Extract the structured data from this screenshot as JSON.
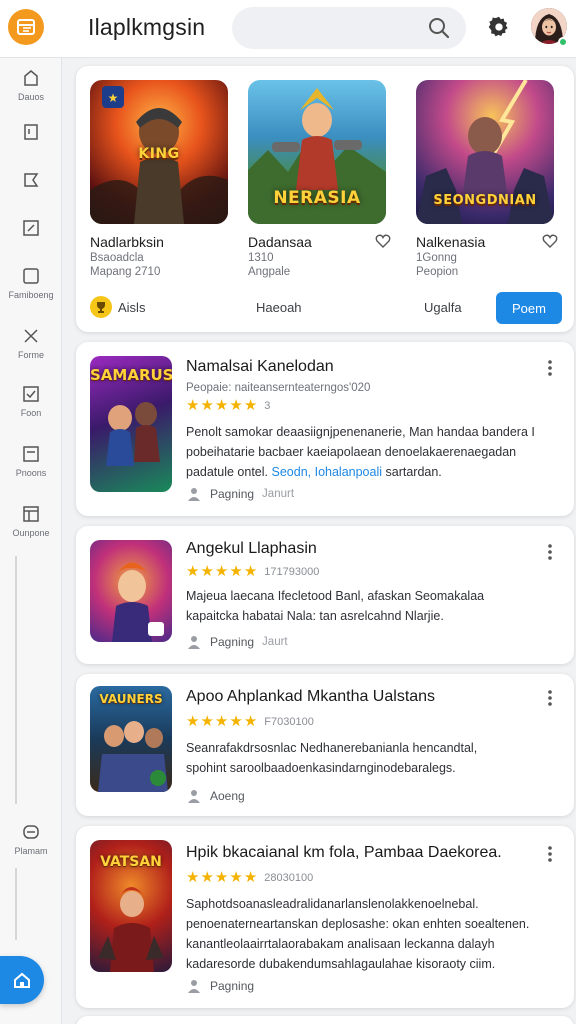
{
  "header": {
    "title": "Ilaplkmgsin",
    "search_placeholder": "",
    "icons": {
      "logo": "app-grid-logo-icon",
      "search": "search-icon",
      "settings": "gear-icon",
      "avatar": "user-avatar"
    }
  },
  "sidebar": {
    "items": [
      {
        "label": "Dauos",
        "icon": "home-icon"
      },
      {
        "label": "",
        "icon": "document-icon"
      },
      {
        "label": "",
        "icon": "tag-icon"
      },
      {
        "label": "",
        "icon": "edit-icon"
      },
      {
        "label": "Famiboeng",
        "icon": "square-icon"
      },
      {
        "label": "Forme",
        "icon": "close-icon"
      },
      {
        "label": "Foon",
        "icon": "checkbox-icon"
      },
      {
        "label": "Pnoons",
        "icon": "list-icon"
      },
      {
        "label": "Ounpone",
        "icon": "layout-icon"
      },
      {
        "label": "Plamam",
        "icon": "archive-icon"
      }
    ],
    "fab_icon": "home-icon"
  },
  "featured": {
    "items": [
      {
        "name": "Nadlarbksin",
        "line1": "Bsaoadcla",
        "line2": "Mapang 2710",
        "art_title": "KING",
        "like_icon": ""
      },
      {
        "name": "Dadansaa",
        "line1": "1310",
        "line2": "Angpale",
        "art_title": "NERASIA",
        "like_icon": "heart-icon"
      },
      {
        "name": "Nalkenasia",
        "line1": "1Gonng",
        "line2": "Peopion",
        "art_title": "SEONGDNIAN",
        "like_icon": "heart-icon"
      }
    ],
    "footer": {
      "left": "Aisls",
      "middle": "Haeoah",
      "right": "Ugalfa",
      "button": "Poem"
    }
  },
  "list": [
    {
      "title": "Namalsai Kanelodan",
      "meta": "Peopaie: naiteansernteaterngos'020",
      "stars": 5,
      "rating": "3",
      "art_title": "SAMARUS",
      "desc1": "Penolt samokar deaasiignjpenenanerie, Man handaa bandera I",
      "desc2": "pobeihatarie bacbaer kaeiapolaean denoelakaerenaegadan",
      "desc3_pre": "padatule ontel.",
      "desc3_link": "Seodn, Iohalanpoali",
      "desc3_post": "sartardan.",
      "foot_label": "Pagning",
      "foot_extra": "Janurt"
    },
    {
      "title": "Angekul Llaphasin",
      "meta": "",
      "stars": 5,
      "rating": "171793000",
      "art_title": "",
      "desc1": "Majeua laecana Ifecletood Banl, afaskan Seomakalaa",
      "desc2": "kapaitcka habatai Nala: tan asrelcahnd Nlarjie.",
      "desc3_pre": "",
      "desc3_link": "",
      "desc3_post": "",
      "foot_label": "Pagning",
      "foot_extra": "Jaurt"
    },
    {
      "title": "Apoo Ahplankad Mkantha Ualstans",
      "meta": "",
      "stars": 5,
      "rating": "F7030100",
      "art_title": "VAUNERS",
      "desc1": "Seanrafakdrsosnlac Nedhanerebanianla hencandtal,",
      "desc2": "spohint saroolbaadoenkasindarnginodebaralegs.",
      "desc3_pre": "",
      "desc3_link": "",
      "desc3_post": "",
      "foot_label": "Aoeng",
      "foot_extra": ""
    },
    {
      "title": "Hpik bkacaianal km fola, Pambaa Daekorea.",
      "meta": "",
      "stars": 5,
      "rating": "28030100",
      "art_title": "VATSAN",
      "desc1": "Saphotdsoanasleadralidanarlanslenolakkenoelnebal.",
      "desc2": "penoenaterneartanskan deplosashe: okan enhten soealtenen.",
      "desc3": "kanantleolaairrtalaorabakam analisaan leckanna dalayh",
      "desc4": "kadaresorde dubakendumsahlagaulahae kisoraoty ciim.",
      "foot_label": "Pagning",
      "foot_extra": ""
    }
  ],
  "colors": {
    "accent": "#1e88e5",
    "logo": "#f39a1e",
    "star": "#f5b301",
    "online": "#2ec16a"
  }
}
